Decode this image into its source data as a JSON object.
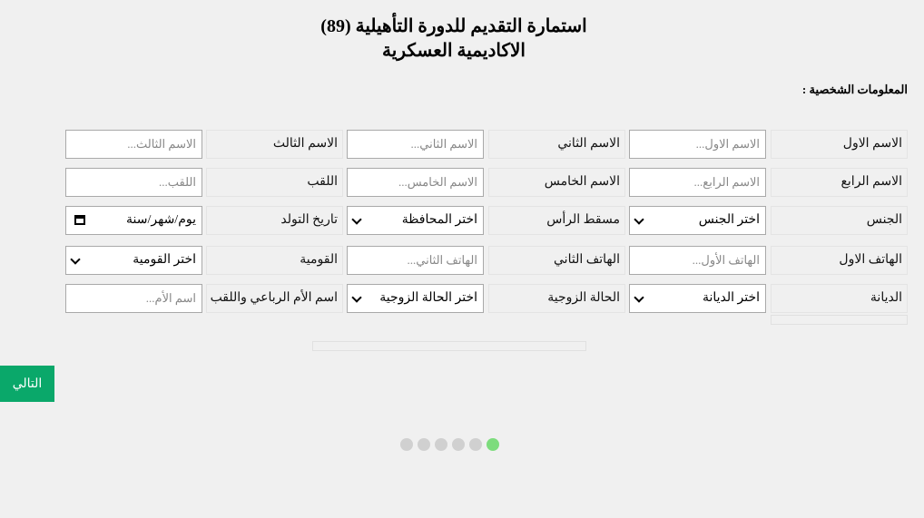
{
  "header": {
    "title_line1": "استمارة التقديم للدورة التأهيلية (89)",
    "title_line2": "الاكاديمية العسكرية"
  },
  "section": {
    "heading": "المعلومات الشخصية :"
  },
  "fields": {
    "first_name": {
      "label": "الاسم الاول",
      "placeholder": "الاسم الاول..."
    },
    "second_name": {
      "label": "الاسم الثاني",
      "placeholder": "الاسم الثاني..."
    },
    "third_name": {
      "label": "الاسم الثالث",
      "placeholder": "الاسم الثالث..."
    },
    "fourth_name": {
      "label": "الاسم الرابع",
      "placeholder": "الاسم الرابع..."
    },
    "fifth_name": {
      "label": "الاسم الخامس",
      "placeholder": "الاسم الخامس..."
    },
    "surname": {
      "label": "اللقب",
      "placeholder": "اللقب..."
    },
    "gender": {
      "label": "الجنس",
      "selected": "اختر الجنس"
    },
    "birthplace": {
      "label": "مسقط الرأس",
      "selected": "اختر المحافظة"
    },
    "birthdate": {
      "label": "تاريخ التولد",
      "value": "يوم/شهر/سنة"
    },
    "phone1": {
      "label": "الهاتف الاول",
      "placeholder": "الهاتف الأول..."
    },
    "phone2": {
      "label": "الهاتف الثاني",
      "placeholder": "الهاتف الثاني..."
    },
    "nationality": {
      "label": "القومية",
      "selected": "اختر القومية"
    },
    "religion": {
      "label": "الديانة",
      "selected": "اختر الديانة"
    },
    "marital_status": {
      "label": "الحالة الزوجية",
      "selected": "اختر الحالة الزوجية"
    },
    "mother_name": {
      "label": "اسم الأم الرباعي واللقب",
      "placeholder": "اسم الأم..."
    }
  },
  "next_button": {
    "label": "التالي"
  },
  "progress": {
    "total_steps": 6,
    "current_step": 1
  },
  "colors": {
    "accent": "#0aa86a",
    "active_dot": "#7ddc7d",
    "inactive_dot": "#d0d0d0"
  }
}
